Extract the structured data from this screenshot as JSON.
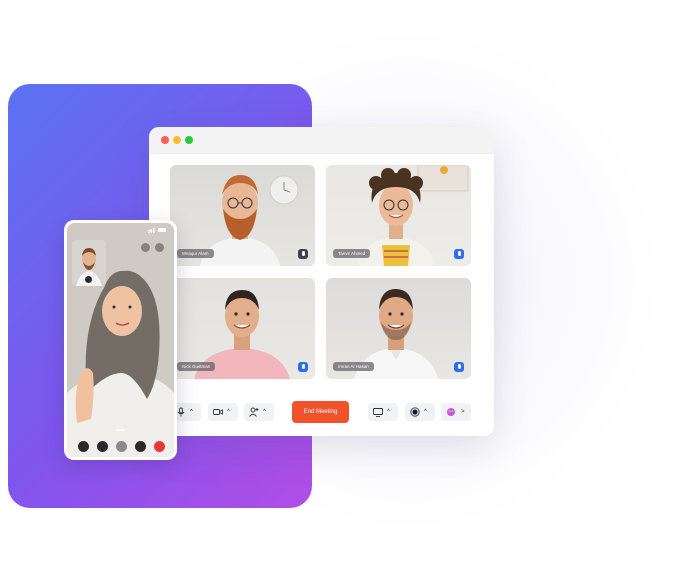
{
  "participants": [
    {
      "name": "Mnaqur Alam",
      "mic": "dark"
    },
    {
      "name": "Tanvir Ahmed",
      "mic": "blue"
    },
    {
      "name": "Nick Gustman",
      "mic": "blue"
    },
    {
      "name": "Imran Al Hasan",
      "mic": "blue"
    }
  ],
  "controls": {
    "end_meeting_label": "End Meeting",
    "chevron_up": "^",
    "chevron_right": ">"
  },
  "colors": {
    "gradient_start": "#5a73f2",
    "gradient_end": "#b24de6",
    "end_button": "#f0532c",
    "mic_active": "#2b6cf0",
    "traffic_red": "#fe5f57",
    "traffic_yellow": "#febc2e",
    "traffic_green": "#28c840",
    "phone_end_call": "#e53935"
  },
  "icons": [
    "microphone-icon",
    "camera-icon",
    "add-user-icon",
    "screen-share-icon",
    "record-icon",
    "reactions-icon"
  ]
}
